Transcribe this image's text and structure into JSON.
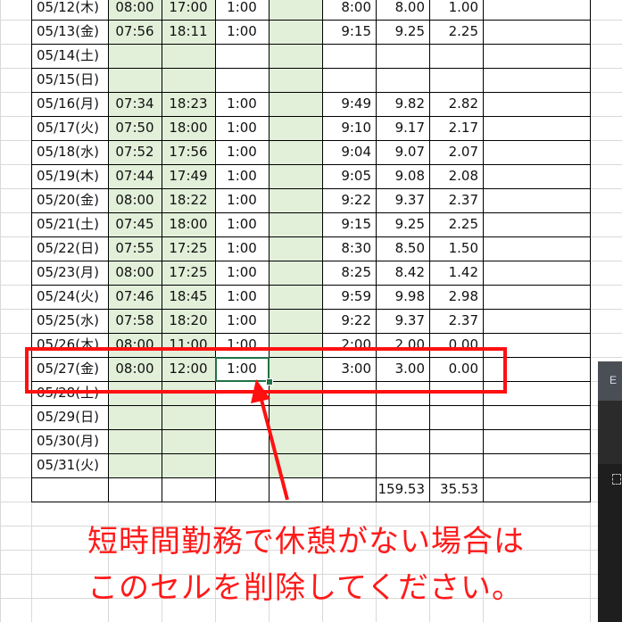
{
  "sheet": {
    "rows": [
      {
        "date": "05/12(木)",
        "start": "08:00",
        "end": "17:00",
        "break": "1:00",
        "green": "",
        "work": "8:00",
        "hours": "8.00",
        "overtime": "1.00"
      },
      {
        "date": "05/13(金)",
        "start": "07:56",
        "end": "18:11",
        "break": "1:00",
        "green": "",
        "work": "9:15",
        "hours": "9.25",
        "overtime": "2.25"
      },
      {
        "date": "05/14(土)",
        "start": "",
        "end": "",
        "break": "",
        "green": "",
        "work": "",
        "hours": "",
        "overtime": ""
      },
      {
        "date": "05/15(日)",
        "start": "",
        "end": "",
        "break": "",
        "green": "",
        "work": "",
        "hours": "",
        "overtime": ""
      },
      {
        "date": "05/16(月)",
        "start": "07:34",
        "end": "18:23",
        "break": "1:00",
        "green": "",
        "work": "9:49",
        "hours": "9.82",
        "overtime": "2.82"
      },
      {
        "date": "05/17(火)",
        "start": "07:50",
        "end": "18:00",
        "break": "1:00",
        "green": "",
        "work": "9:10",
        "hours": "9.17",
        "overtime": "2.17"
      },
      {
        "date": "05/18(水)",
        "start": "07:52",
        "end": "17:56",
        "break": "1:00",
        "green": "",
        "work": "9:04",
        "hours": "9.07",
        "overtime": "2.07"
      },
      {
        "date": "05/19(木)",
        "start": "07:44",
        "end": "17:49",
        "break": "1:00",
        "green": "",
        "work": "9:05",
        "hours": "9.08",
        "overtime": "2.08"
      },
      {
        "date": "05/20(金)",
        "start": "08:00",
        "end": "18:22",
        "break": "1:00",
        "green": "",
        "work": "9:22",
        "hours": "9.37",
        "overtime": "2.37"
      },
      {
        "date": "05/21(土)",
        "start": "07:45",
        "end": "18:00",
        "break": "1:00",
        "green": "",
        "work": "9:15",
        "hours": "9.25",
        "overtime": "2.25"
      },
      {
        "date": "05/22(日)",
        "start": "07:55",
        "end": "17:25",
        "break": "1:00",
        "green": "",
        "work": "8:30",
        "hours": "8.50",
        "overtime": "1.50"
      },
      {
        "date": "05/23(月)",
        "start": "08:00",
        "end": "17:25",
        "break": "1:00",
        "green": "",
        "work": "8:25",
        "hours": "8.42",
        "overtime": "1.42"
      },
      {
        "date": "05/24(火)",
        "start": "07:46",
        "end": "18:45",
        "break": "1:00",
        "green": "",
        "work": "9:59",
        "hours": "9.98",
        "overtime": "2.98"
      },
      {
        "date": "05/25(水)",
        "start": "07:58",
        "end": "18:20",
        "break": "1:00",
        "green": "",
        "work": "9:22",
        "hours": "9.37",
        "overtime": "2.37"
      },
      {
        "date": "05/26(木)",
        "start": "08:00",
        "end": "11:00",
        "break": "1:00",
        "green": "",
        "work": "2:00",
        "hours": "2.00",
        "overtime": "0.00"
      },
      {
        "date": "05/27(金)",
        "start": "08:00",
        "end": "12:00",
        "break": "1:00",
        "green": "",
        "work": "3:00",
        "hours": "3.00",
        "overtime": "0.00"
      },
      {
        "date": "05/28(土)",
        "start": "",
        "end": "",
        "break": "",
        "green": "",
        "work": "",
        "hours": "",
        "overtime": ""
      },
      {
        "date": "05/29(日)",
        "start": "",
        "end": "",
        "break": "",
        "green": "",
        "work": "",
        "hours": "",
        "overtime": ""
      },
      {
        "date": "05/30(月)",
        "start": "",
        "end": "",
        "break": "",
        "green": "",
        "work": "",
        "hours": "",
        "overtime": ""
      },
      {
        "date": "05/31(火)",
        "start": "",
        "end": "",
        "break": "",
        "green": "",
        "work": "",
        "hours": "",
        "overtime": ""
      }
    ],
    "totals": {
      "hours": "159.53",
      "overtime": "35.53"
    },
    "selected_row_index": 15,
    "selected_col": "break",
    "colors": {
      "green_fill": "#e2efd9",
      "selection": "#217346",
      "annotation": "#ff1a1a"
    }
  },
  "annotation": {
    "line1": "短時間勤務で休憩がない場合は",
    "line2": "このセルを削除してください。"
  },
  "side_panel": {
    "label": "E",
    "icon": "dashed-box-icon"
  }
}
